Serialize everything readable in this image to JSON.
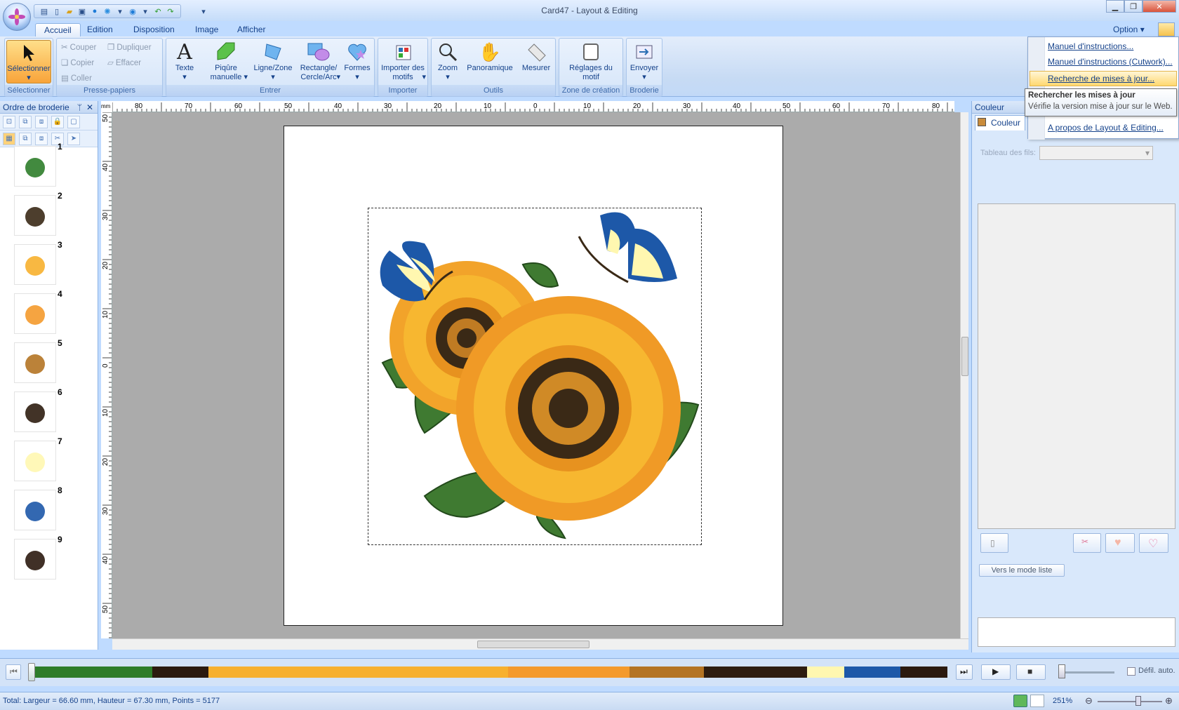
{
  "window": {
    "title": "Card47 - Layout & Editing",
    "min": "▁",
    "max": "❐",
    "close": "✕"
  },
  "tabs": [
    "Accueil",
    "Edition",
    "Disposition",
    "Image",
    "Afficher"
  ],
  "option_label": "Option",
  "ribbon": {
    "select": {
      "label": "Sélectionner",
      "group": "Sélectionner"
    },
    "clipboard": {
      "cut": "Couper",
      "duplicate": "Dupliquer",
      "copy": "Copier",
      "erase": "Effacer",
      "paste": "Coller",
      "group": "Presse-papiers"
    },
    "enter": {
      "text": "Texte",
      "manual": "Piqûre manuelle",
      "line": "Ligne/Zone",
      "rect": "Rectangle/ Cercle/Arc",
      "shapes": "Formes",
      "group": "Entrer"
    },
    "import": {
      "motifs": "Importer des motifs",
      "group": "Importer"
    },
    "tools": {
      "zoom": "Zoom",
      "pan": "Panoramique",
      "measure": "Mesurer",
      "group": "Outils"
    },
    "zone": {
      "settings": "Réglages du motif",
      "group": "Zone de création"
    },
    "embroidery": {
      "send": "Envoyer",
      "group": "Broderie"
    }
  },
  "left_panel": {
    "title": "Ordre de broderie",
    "pin": "ᛘ",
    "close": "✕",
    "items": [
      "1",
      "2",
      "3",
      "4",
      "5",
      "6",
      "7",
      "8",
      "9"
    ]
  },
  "ruler": {
    "unit": "mm",
    "top": [
      "80",
      "70",
      "60",
      "50",
      "40",
      "30",
      "20",
      "10",
      "0",
      "10",
      "20",
      "30",
      "40",
      "50",
      "60",
      "70",
      "80"
    ],
    "left": [
      "50",
      "40",
      "30",
      "20",
      "10",
      "0",
      "10",
      "20",
      "30",
      "40",
      "50"
    ]
  },
  "right_panel": {
    "title": "Couleur",
    "tab": "Couleur",
    "thread_table": "Tableau des fils:",
    "list_mode": "Vers le mode liste"
  },
  "menu": {
    "items": [
      "Manuel d'instructions...",
      "Manuel d'instructions (Cutwork)...",
      "Recherche de mises à jour...",
      "A propos de Layout & Editing..."
    ]
  },
  "tooltip": {
    "title": "Rechercher les mises à jour",
    "body": "Vérifie la version mise à jour sur le Web."
  },
  "timeline": {
    "auto": "Défil. auto.",
    "colors": [
      {
        "c": "#2e7d2a",
        "w": 13
      },
      {
        "c": "#2b1a0f",
        "w": 6
      },
      {
        "c": "#f7b02e",
        "w": 32
      },
      {
        "c": "#f49a2c",
        "w": 13
      },
      {
        "c": "#b47424",
        "w": 8
      },
      {
        "c": "#2e1d10",
        "w": 11
      },
      {
        "c": "#fff7b0",
        "w": 4
      },
      {
        "c": "#1d58a8",
        "w": 6
      },
      {
        "c": "#2b1a0f",
        "w": 5
      }
    ]
  },
  "status": {
    "text": "Total: Largeur = 66.60 mm, Hauteur = 67.30 mm, Points = 5177",
    "zoom": "251%"
  }
}
